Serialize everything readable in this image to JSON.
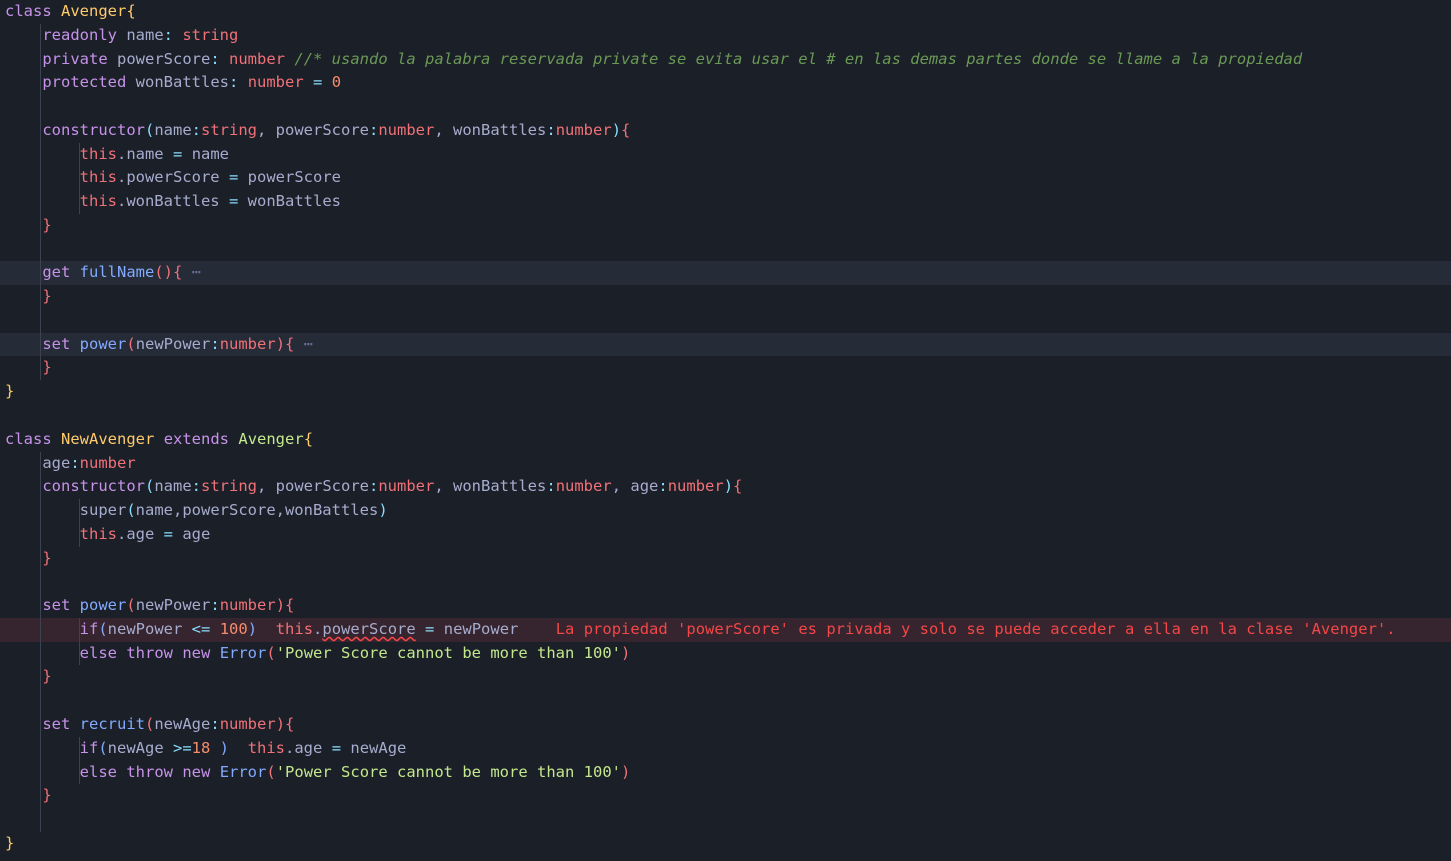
{
  "editor": {
    "language": "typescript",
    "theme_background": "#1b1f28",
    "folded_line_background": "#262b38",
    "error_line_background": "#36242e",
    "colors": {
      "keyword": "#c792ea",
      "class_name": "#ffcb6b",
      "type": "#f07178",
      "function": "#82aaff",
      "identifier": "#a6accd",
      "operator": "#89ddff",
      "number": "#f78c6c",
      "string": "#c3e88d",
      "comment": "#6a9955",
      "error": "#f44747"
    }
  },
  "code": {
    "l1": {
      "kw_class": "class",
      "name": "Avenger",
      "brace": "{"
    },
    "l2": {
      "kw": "readonly",
      "prop": "name",
      "colon": ":",
      "type": "string"
    },
    "l3": {
      "kw": "private",
      "prop": "powerScore",
      "colon": ":",
      "type": "number",
      "comment": "//* usando la palabra reservada private se evita usar el # en las demas partes donde se llame a la propiedad"
    },
    "l4": {
      "kw": "protected",
      "prop": "wonBattles",
      "colon": ":",
      "type": "number",
      "eq": "=",
      "value": "0"
    },
    "l5": {
      "blank": ""
    },
    "l6": {
      "kw": "constructor",
      "open": "(",
      "p1": "name",
      "c1": ":",
      "t1": "string",
      "sep1": ", ",
      "p2": "powerScore",
      "c2": ":",
      "t2": "number",
      "sep2": ", ",
      "p3": "wonBattles",
      "c3": ":",
      "t3": "number",
      "close": ")",
      "brace": "{"
    },
    "l7": {
      "this": "this",
      "member": ".name",
      "eq": "=",
      "value": "name"
    },
    "l8": {
      "this": "this",
      "member": ".powerScore",
      "eq": "=",
      "value": "powerScore"
    },
    "l9": {
      "this": "this",
      "member": ".wonBattles",
      "eq": "=",
      "value": "wonBattles"
    },
    "l10": {
      "brace": "}"
    },
    "l11": {
      "blank": ""
    },
    "l12": {
      "kw": "get",
      "fn": "fullName",
      "parens": "()",
      "brace": "{",
      "fold": "⋯"
    },
    "l13": {
      "brace": "}"
    },
    "l14": {
      "blank": ""
    },
    "l15": {
      "kw": "set",
      "fn": "power",
      "open": "(",
      "param": "newPower",
      "colon": ":",
      "type": "number",
      "close": ")",
      "brace": "{",
      "fold": "⋯"
    },
    "l16": {
      "brace": "}"
    },
    "l17": {
      "brace": "}"
    },
    "l18": {
      "blank": ""
    },
    "l19": {
      "kw_class": "class",
      "name": "NewAvenger",
      "kw_extends": "extends",
      "parent": "Avenger",
      "brace": "{"
    },
    "l20": {
      "prop": "age",
      "colon": ":",
      "type": "number"
    },
    "l21": {
      "kw": "constructor",
      "open": "(",
      "p1": "name",
      "c1": ":",
      "t1": "string",
      "sep1": ", ",
      "p2": "powerScore",
      "c2": ":",
      "t2": "number",
      "sep2": ", ",
      "p3": "wonBattles",
      "c3": ":",
      "t3": "number",
      "sep3": ", ",
      "p4": "age",
      "c4": ":",
      "t4": "number",
      "close": ")",
      "brace": "{"
    },
    "l22": {
      "fn": "super",
      "open": "(",
      "args": "name,powerScore,wonBattles",
      "close": ")"
    },
    "l23": {
      "this": "this",
      "member": ".age",
      "eq": "=",
      "value": "age"
    },
    "l24": {
      "brace": "}"
    },
    "l25": {
      "blank": ""
    },
    "l26": {
      "kw": "set",
      "fn": "power",
      "open": "(",
      "param": "newPower",
      "colon": ":",
      "type": "number",
      "close": ")",
      "brace": "{"
    },
    "l27": {
      "kw_if": "if",
      "open": "(",
      "left": "newPower",
      "op": "<=",
      "right": "100",
      "close": ")",
      "this": "this",
      "member_dot": ".",
      "member": "powerScore",
      "eq": "=",
      "value": "newPower",
      "error_message": "La propiedad 'powerScore' es privada y solo se puede acceder a ella en la clase 'Avenger'."
    },
    "l28": {
      "kw_else": "else",
      "kw_throw": "throw",
      "kw_new": "new",
      "fn": "Error",
      "open": "(",
      "string": "'Power Score cannot be more than 100'",
      "close": ")"
    },
    "l29": {
      "brace": "}"
    },
    "l30": {
      "blank": ""
    },
    "l31": {
      "kw": "set",
      "fn": "recruit",
      "open": "(",
      "param": "newAge",
      "colon": ":",
      "type": "number",
      "close": ")",
      "brace": "{"
    },
    "l32": {
      "kw_if": "if",
      "open": "(",
      "left": "newAge ",
      "op": ">=",
      "right": "18",
      "close": " )",
      "this": "this",
      "member": ".age",
      "eq": "=",
      "value": "newAge"
    },
    "l33": {
      "kw_else": "else",
      "kw_throw": "throw",
      "kw_new": "new",
      "fn": "Error",
      "open": "(",
      "string": "'Power Score cannot be more than 100'",
      "close": ")"
    },
    "l34": {
      "brace": "}"
    },
    "l35": {
      "blank": ""
    },
    "l36": {
      "brace": "}"
    }
  }
}
